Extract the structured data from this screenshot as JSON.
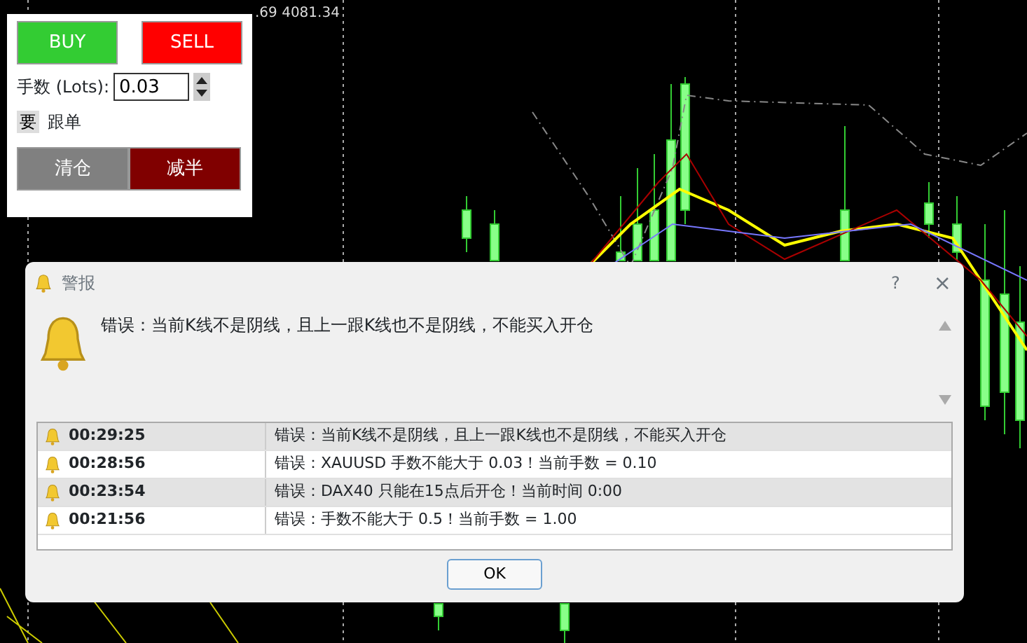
{
  "chart_header": ".69 4081.34",
  "trade_panel": {
    "buy": "BUY",
    "sell": "SELL",
    "lots_label": "手数 (Lots):",
    "lots_value": "0.03",
    "follow_toggle": "要",
    "follow_label": "跟单",
    "close_all": "清仓",
    "halve": "减半"
  },
  "alert_dialog": {
    "title": "警报",
    "help": "?",
    "close": "×",
    "message": "错误：当前K线不是阴线，且上一跟K线也不是阴线，不能买入开仓",
    "rows": [
      {
        "time": "00:29:25",
        "text": "错误：当前K线不是阴线，且上一跟K线也不是阴线，不能买入开仓"
      },
      {
        "time": "00:28:56",
        "text": "错误：XAUUSD 手数不能大于 0.03！当前手数 = 0.10"
      },
      {
        "time": "00:23:54",
        "text": "错误：DAX40 只能在15点后开仓！当前时间 0:00"
      },
      {
        "time": "00:21:56",
        "text": "错误：手数不能大于 0.5！当前手数 = 1.00"
      }
    ],
    "ok": "OK"
  }
}
